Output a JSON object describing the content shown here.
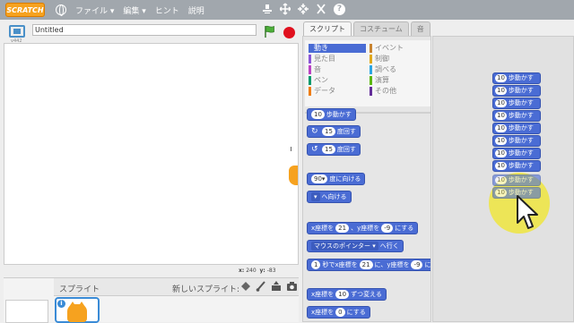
{
  "menubar": {
    "logo": "SCRATCH",
    "items": [
      "ファイル ▾",
      "編集 ▾",
      "ヒント",
      "説明"
    ],
    "tool_icons": [
      "stamp-icon",
      "grow-icon",
      "shrink-icon",
      "scissors-icon",
      "help-icon"
    ]
  },
  "stage": {
    "title_value": "Untitled",
    "version": "v442",
    "coords": {
      "x_label": "x:",
      "x_value": "240",
      "y_label": "y:",
      "y_value": "-83"
    }
  },
  "sprites": {
    "label": "スプライト",
    "new_sprite_label": "新しいスプライト:",
    "new_sprite_icons": [
      "paint-sprite-icon",
      "brush-icon",
      "upload-icon",
      "camera-icon"
    ],
    "info": "i"
  },
  "tabs": [
    "スクリプト",
    "コスチューム",
    "音"
  ],
  "categories": [
    {
      "label": "動き",
      "color": "#4a6cd4",
      "selected": true
    },
    {
      "label": "見た目",
      "color": "#8a55d7",
      "selected": false
    },
    {
      "label": "音",
      "color": "#bb42c3",
      "selected": false
    },
    {
      "label": "ペン",
      "color": "#0e9a6c",
      "selected": false
    },
    {
      "label": "データ",
      "color": "#ee7d16",
      "selected": false
    },
    {
      "label": "イベント",
      "color": "#c88330",
      "selected": false
    },
    {
      "label": "制御",
      "color": "#e1a91a",
      "selected": false
    },
    {
      "label": "調べる",
      "color": "#2ca5e2",
      "selected": false
    },
    {
      "label": "演算",
      "color": "#5cb712",
      "selected": false
    },
    {
      "label": "その他",
      "color": "#632d99",
      "selected": false
    }
  ],
  "palette_blocks": {
    "move": {
      "num": "10",
      "text": "歩動かす"
    },
    "turn_right": {
      "num": "15",
      "text": "度回す"
    },
    "turn_left": {
      "num": "15",
      "text": "度回す"
    },
    "point_dir": {
      "num": "90▾",
      "text": "度に向ける"
    },
    "point_towards": {
      "dd": "▾",
      "text": "へ向ける"
    },
    "goto_xy": {
      "a": "x座標を",
      "x": "21",
      "b": "、y座標を",
      "y": "-9",
      "c": "にする"
    },
    "goto_mouse": {
      "dd": "マウスのポインター ▾",
      "text": "へ行く"
    },
    "glide": {
      "num": "1",
      "a": "秒でx座標を",
      "x": "21",
      "b": "に、y座標を",
      "y": "-9",
      "c": "に変"
    },
    "change_x": {
      "a": "x座標を",
      "num": "10",
      "b": "ずつ変える"
    },
    "set_x": {
      "a": "x座標を",
      "num": "0",
      "b": "にする"
    }
  },
  "script_blocks": [
    {
      "num": "10",
      "text": "歩動かす"
    },
    {
      "num": "10",
      "text": "歩動かす"
    },
    {
      "num": "10",
      "text": "歩動かす"
    },
    {
      "num": "10",
      "text": "歩動かす"
    },
    {
      "num": "10",
      "text": "歩動かす"
    },
    {
      "num": "10",
      "text": "歩動かす"
    },
    {
      "num": "10",
      "text": "歩動かす"
    },
    {
      "num": "10",
      "text": "歩動かす"
    },
    {
      "num": "10",
      "text": "歩動かす"
    },
    {
      "num": "10",
      "text": "歩動かす"
    }
  ]
}
